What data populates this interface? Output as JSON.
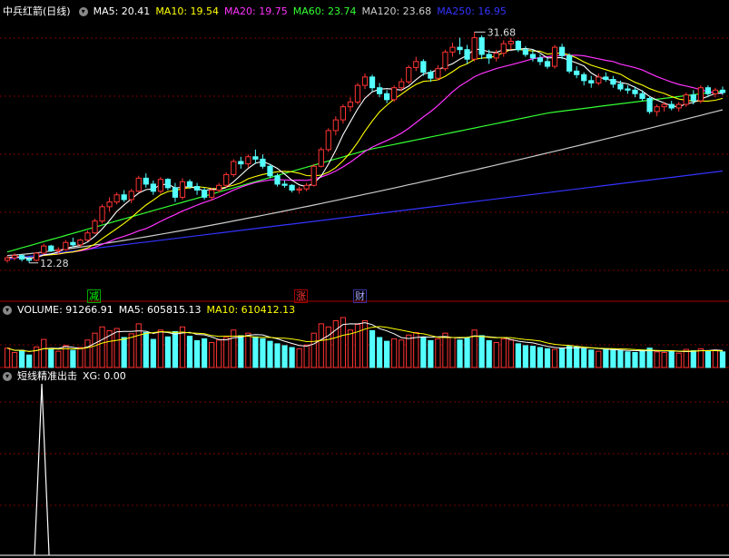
{
  "header": {
    "title": "中兵红箭(日线)",
    "ma_items": [
      {
        "label": "MA5: 20.41",
        "color": "#ffffff"
      },
      {
        "label": "MA10: 19.54",
        "color": "#ffff00"
      },
      {
        "label": "MA20: 19.75",
        "color": "#ff33ff"
      },
      {
        "label": "MA60: 23.74",
        "color": "#33ff33"
      },
      {
        "label": "MA120: 23.68",
        "color": "#cccccc"
      },
      {
        "label": "MA250: 16.95",
        "color": "#3333ff"
      }
    ]
  },
  "volume_header": {
    "label": "VOLUME: 91266.91",
    "ma5": "MA5: 605815.13",
    "ma10": "MA10: 610412.13"
  },
  "indicator_header": {
    "name": "短线精准出击",
    "value": "XG: 0.00"
  },
  "signals": [
    {
      "text": "减",
      "color": "#00ff00"
    },
    {
      "text": "涨",
      "color": "#ff3333"
    },
    {
      "text": "财",
      "color": "#aaaaff"
    }
  ],
  "colors": {
    "up": "#ff3333",
    "down": "#54ffff",
    "ma5": "#ffffff",
    "ma10": "#ffff00",
    "ma20": "#ff33ff",
    "ma60": "#33ff33",
    "ma120": "#cccccc",
    "ma250": "#3333ff",
    "grid": "#7a0000"
  },
  "chart_data": {
    "type": "candlestick",
    "annotations": {
      "high_label": "31.68",
      "low_label": "12.28"
    },
    "price_range": [
      12.28,
      31.68
    ],
    "candles": [
      [
        12.5,
        12.9,
        12.3,
        12.7
      ],
      [
        12.7,
        13.1,
        12.5,
        12.9
      ],
      [
        12.9,
        13.0,
        12.4,
        12.6
      ],
      [
        12.6,
        12.8,
        12.28,
        12.5
      ],
      [
        12.5,
        13.2,
        12.4,
        13.1
      ],
      [
        13.1,
        13.9,
        13.0,
        13.7
      ],
      [
        13.7,
        13.8,
        13.2,
        13.3
      ],
      [
        13.3,
        13.6,
        13.0,
        13.4
      ],
      [
        13.4,
        14.2,
        13.3,
        14.0
      ],
      [
        14.0,
        14.4,
        13.6,
        13.8
      ],
      [
        13.8,
        14.3,
        13.6,
        14.2
      ],
      [
        14.2,
        15.0,
        14.1,
        14.8
      ],
      [
        14.8,
        16.0,
        14.7,
        15.8
      ],
      [
        15.8,
        17.2,
        15.6,
        17.0
      ],
      [
        17.0,
        17.8,
        16.6,
        17.4
      ],
      [
        17.4,
        18.2,
        17.2,
        18.0
      ],
      [
        18.0,
        18.4,
        17.4,
        17.6
      ],
      [
        17.6,
        18.5,
        17.3,
        18.3
      ],
      [
        18.3,
        19.6,
        18.2,
        19.4
      ],
      [
        19.4,
        19.8,
        18.6,
        18.9
      ],
      [
        18.9,
        19.2,
        18.0,
        18.3
      ],
      [
        18.3,
        19.5,
        18.1,
        19.3
      ],
      [
        19.3,
        19.4,
        18.4,
        18.6
      ],
      [
        18.6,
        19.0,
        17.4,
        17.8
      ],
      [
        17.8,
        19.4,
        17.6,
        19.1
      ],
      [
        19.1,
        19.3,
        18.5,
        18.7
      ],
      [
        18.7,
        19.0,
        18.0,
        18.4
      ],
      [
        18.4,
        18.6,
        17.6,
        17.8
      ],
      [
        17.8,
        18.6,
        17.5,
        18.4
      ],
      [
        18.4,
        19.0,
        18.2,
        18.8
      ],
      [
        18.8,
        19.9,
        18.6,
        19.7
      ],
      [
        19.7,
        21.0,
        19.5,
        20.8
      ],
      [
        20.8,
        21.2,
        20.2,
        20.6
      ],
      [
        20.6,
        21.4,
        20.3,
        21.2
      ],
      [
        21.2,
        21.8,
        20.6,
        21.0
      ],
      [
        21.0,
        21.4,
        20.2,
        20.4
      ],
      [
        20.4,
        20.6,
        19.4,
        19.6
      ],
      [
        19.6,
        19.8,
        18.7,
        18.9
      ],
      [
        18.9,
        19.2,
        18.6,
        18.8
      ],
      [
        18.8,
        18.9,
        18.2,
        18.4
      ],
      [
        18.4,
        18.7,
        18.1,
        18.5
      ],
      [
        18.5,
        19.0,
        18.3,
        18.8
      ],
      [
        18.8,
        20.6,
        18.7,
        20.4
      ],
      [
        20.4,
        22.0,
        20.3,
        21.8
      ],
      [
        21.8,
        23.6,
        21.6,
        23.4
      ],
      [
        23.4,
        24.6,
        23.0,
        24.3
      ],
      [
        24.3,
        25.6,
        24.0,
        25.4
      ],
      [
        25.4,
        26.2,
        25.0,
        25.8
      ],
      [
        25.8,
        27.4,
        25.6,
        27.2
      ],
      [
        27.2,
        28.2,
        26.9,
        27.9
      ],
      [
        27.9,
        28.1,
        26.7,
        27.0
      ],
      [
        27.0,
        27.4,
        26.2,
        26.5
      ],
      [
        26.5,
        26.8,
        25.7,
        26.0
      ],
      [
        26.0,
        27.2,
        25.8,
        27.0
      ],
      [
        27.0,
        27.8,
        26.7,
        27.5
      ],
      [
        27.5,
        28.9,
        27.3,
        28.7
      ],
      [
        28.7,
        29.6,
        28.4,
        29.2
      ],
      [
        29.2,
        29.4,
        28.0,
        28.3
      ],
      [
        28.3,
        28.5,
        27.5,
        27.8
      ],
      [
        27.8,
        28.9,
        27.6,
        28.6
      ],
      [
        28.6,
        30.2,
        28.4,
        30.0
      ],
      [
        30.0,
        30.8,
        29.6,
        30.4
      ],
      [
        30.4,
        31.2,
        29.8,
        30.2
      ],
      [
        30.2,
        30.6,
        29.0,
        29.4
      ],
      [
        29.4,
        31.68,
        29.2,
        31.2
      ],
      [
        31.2,
        31.4,
        29.4,
        29.8
      ],
      [
        29.8,
        30.2,
        29.0,
        29.5
      ],
      [
        29.5,
        30.2,
        29.2,
        29.9
      ],
      [
        29.9,
        31.0,
        29.6,
        30.7
      ],
      [
        30.7,
        31.2,
        30.2,
        30.9
      ],
      [
        30.9,
        31.0,
        30.0,
        30.2
      ],
      [
        30.2,
        30.5,
        29.6,
        29.8
      ],
      [
        29.8,
        30.2,
        29.2,
        29.5
      ],
      [
        29.5,
        29.8,
        28.9,
        29.2
      ],
      [
        29.2,
        29.5,
        28.6,
        28.8
      ],
      [
        28.8,
        30.6,
        28.6,
        30.4
      ],
      [
        30.4,
        30.7,
        29.4,
        29.7
      ],
      [
        29.7,
        29.9,
        28.2,
        28.4
      ],
      [
        28.4,
        28.8,
        27.8,
        28.1
      ],
      [
        28.1,
        28.3,
        27.2,
        27.6
      ],
      [
        27.6,
        28.0,
        27.0,
        27.4
      ],
      [
        27.4,
        28.2,
        27.2,
        27.9
      ],
      [
        27.9,
        28.3,
        27.5,
        27.7
      ],
      [
        27.7,
        28.0,
        27.0,
        27.3
      ],
      [
        27.3,
        27.6,
        26.7,
        26.9
      ],
      [
        26.9,
        27.2,
        26.5,
        26.8
      ],
      [
        26.8,
        27.1,
        26.2,
        26.5
      ],
      [
        26.5,
        26.8,
        25.9,
        26.1
      ],
      [
        26.1,
        26.3,
        24.8,
        25.0
      ],
      [
        25.0,
        25.6,
        24.6,
        25.4
      ],
      [
        25.4,
        25.8,
        25.0,
        25.6
      ],
      [
        25.6,
        25.9,
        25.1,
        25.3
      ],
      [
        25.3,
        25.8,
        25.0,
        25.6
      ],
      [
        25.6,
        26.6,
        25.4,
        26.4
      ],
      [
        26.4,
        26.8,
        25.6,
        25.9
      ],
      [
        25.9,
        27.2,
        25.7,
        27.0
      ],
      [
        27.0,
        27.2,
        26.2,
        26.5
      ],
      [
        26.5,
        27.0,
        26.2,
        26.8
      ],
      [
        26.8,
        27.1,
        26.4,
        26.6
      ]
    ],
    "volume": [
      62,
      48,
      55,
      40,
      66,
      90,
      58,
      52,
      70,
      55,
      64,
      88,
      110,
      130,
      118,
      125,
      96,
      108,
      140,
      112,
      90,
      120,
      98,
      115,
      130,
      100,
      86,
      92,
      80,
      88,
      96,
      120,
      102,
      110,
      98,
      92,
      84,
      76,
      70,
      64,
      60,
      72,
      110,
      140,
      130,
      150,
      160,
      120,
      138,
      150,
      118,
      96,
      84,
      92,
      88,
      104,
      112,
      96,
      86,
      92,
      110,
      96,
      88,
      94,
      120,
      102,
      86,
      80,
      92,
      88,
      76,
      70,
      68,
      64,
      60,
      58,
      62,
      70,
      66,
      60,
      56,
      52,
      60,
      58,
      54,
      50,
      48,
      56,
      62,
      50,
      48,
      52,
      46,
      58,
      54,
      60,
      52,
      56,
      50
    ],
    "volume_ma5": [
      604000,
      610000
    ],
    "signal_spike_index": 1
  }
}
